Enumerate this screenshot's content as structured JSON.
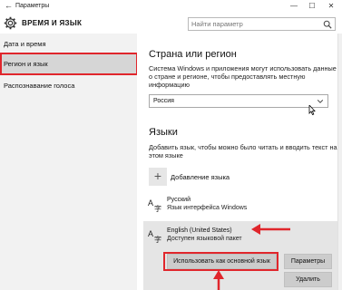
{
  "window": {
    "back_glyph": "←",
    "title": "Параметры",
    "minimize_glyph": "—",
    "maximize_glyph": "☐",
    "close_glyph": "✕"
  },
  "header": {
    "app_title": "ВРЕМЯ И ЯЗЫК",
    "search_placeholder": "Найти параметр"
  },
  "sidebar": {
    "items": [
      {
        "label": "Дата и время",
        "active": false
      },
      {
        "label": "Регион и язык",
        "active": true
      },
      {
        "label": "Распознавание голоса",
        "active": false
      }
    ]
  },
  "region": {
    "heading": "Страна или регион",
    "description_line1": "Система Windows и приложения могут использовать данные",
    "description_line2": "о стране и регионе, чтобы предоставлять местную",
    "description_line3": "информацию",
    "selected_country": "Россия"
  },
  "languages": {
    "heading": "Языки",
    "description_line1": "Добавить язык, чтобы можно было читать и вводить текст на",
    "description_line2": "этом языке",
    "add_label": "Добавление языка",
    "items": [
      {
        "name": "Русский",
        "sub": "Язык интерфейса Windows"
      },
      {
        "name": "English (United States)",
        "sub": "Доступен языковой пакет"
      }
    ],
    "set_default_label": "Использовать как основной язык",
    "options_label": "Параметры",
    "remove_label": "Удалить"
  },
  "colors": {
    "annotation_red": "#e0262c",
    "sidebar_bg": "#f2f2f2",
    "selected_bg": "#e5e5e5"
  }
}
